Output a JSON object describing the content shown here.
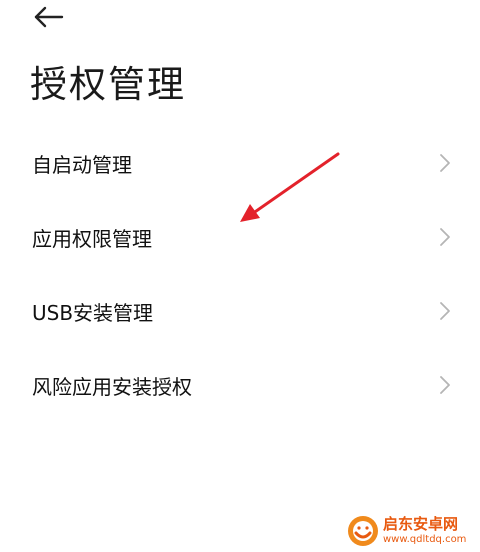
{
  "header": {
    "back_icon": "arrow-left-icon",
    "title": "授权管理"
  },
  "menu": {
    "items": [
      {
        "label": "自启动管理",
        "icon": "chevron-right-icon"
      },
      {
        "label": "应用权限管理",
        "icon": "chevron-right-icon"
      },
      {
        "label": "USB安装管理",
        "icon": "chevron-right-icon"
      },
      {
        "label": "风险应用安装授权",
        "icon": "chevron-right-icon"
      }
    ]
  },
  "annotation": {
    "type": "red-arrow",
    "color": "#e3222b",
    "points_to": "应用权限管理"
  },
  "watermark": {
    "name": "启东安卓网",
    "url": "www.qdltdq.com",
    "color": "#e85a10"
  },
  "colors": {
    "background": "#ffffff",
    "text": "#111111",
    "chevron": "#b5b5b5"
  }
}
